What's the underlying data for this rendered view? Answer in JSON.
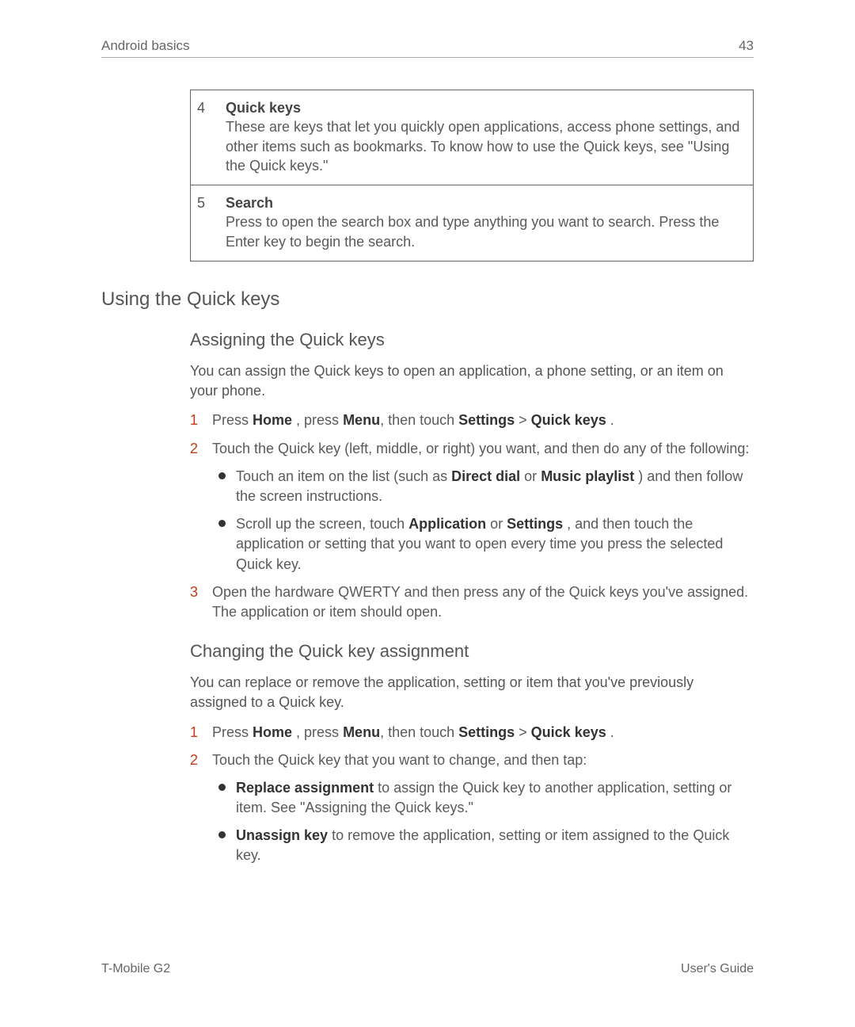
{
  "header": {
    "left": "Android basics",
    "right": "43"
  },
  "box": {
    "rows": [
      {
        "num": "4",
        "title": "Quick keys",
        "desc": "These are keys that let you quickly open applications, access phone settings, and other items such as bookmarks. To know how to use the Quick keys, see \"Using the Quick keys.\""
      },
      {
        "num": "5",
        "title": "Search",
        "desc": "Press to open the search box and type anything you want to search. Press the Enter key to begin the search."
      }
    ]
  },
  "h2": "Using the Quick keys",
  "assign": {
    "h3": "Assigning the Quick keys",
    "intro": "You can assign the Quick keys to open an application, a phone setting, or an item on your phone.",
    "s1": {
      "pre": "Press ",
      "home": "Home",
      "mid1": "    , press ",
      "menu": "Menu",
      "mid2": ", then touch ",
      "settings": "Settings",
      "gt": "  > ",
      "qk": "Quick keys",
      "end": " ."
    },
    "s2": "Touch the Quick key (left, middle, or right) you want, and then do any of the following:",
    "b1": {
      "pre": "Touch an item on the list (such as ",
      "dd": "Direct dial",
      "mid": "  or ",
      "mp": "Music playlist",
      "end": "  ) and then follow the screen instructions."
    },
    "b2": {
      "pre": "Scroll up the screen, touch ",
      "app": "Application",
      "mid": "  or ",
      "set": "Settings",
      "end": " , and then touch the application or setting that you want to open every time you press the selected Quick key."
    },
    "s3": "Open the hardware QWERTY and then press any of the Quick keys you've assigned. The application or item should open."
  },
  "change": {
    "h3": "Changing the Quick key assignment",
    "intro": "You can replace or remove the application, setting or item that you've previously assigned to a Quick key.",
    "s1": {
      "pre": "Press ",
      "home": "Home",
      "mid1": "    , press ",
      "menu": "Menu",
      "mid2": ", then touch ",
      "settings": "Settings",
      "gt": "  > ",
      "qk": "Quick keys",
      "end": " ."
    },
    "s2": "Touch the Quick key that you want to change, and then tap:",
    "b1": {
      "title": "Replace assignment",
      "rest": "  to assign the Quick key to another application, setting or item. See \"Assigning the Quick keys.\""
    },
    "b2": {
      "title": "Unassign key",
      "rest": "  to remove the application, setting or item assigned to the Quick key."
    }
  },
  "footer": {
    "left": "T-Mobile G2",
    "right": "User's Guide"
  }
}
